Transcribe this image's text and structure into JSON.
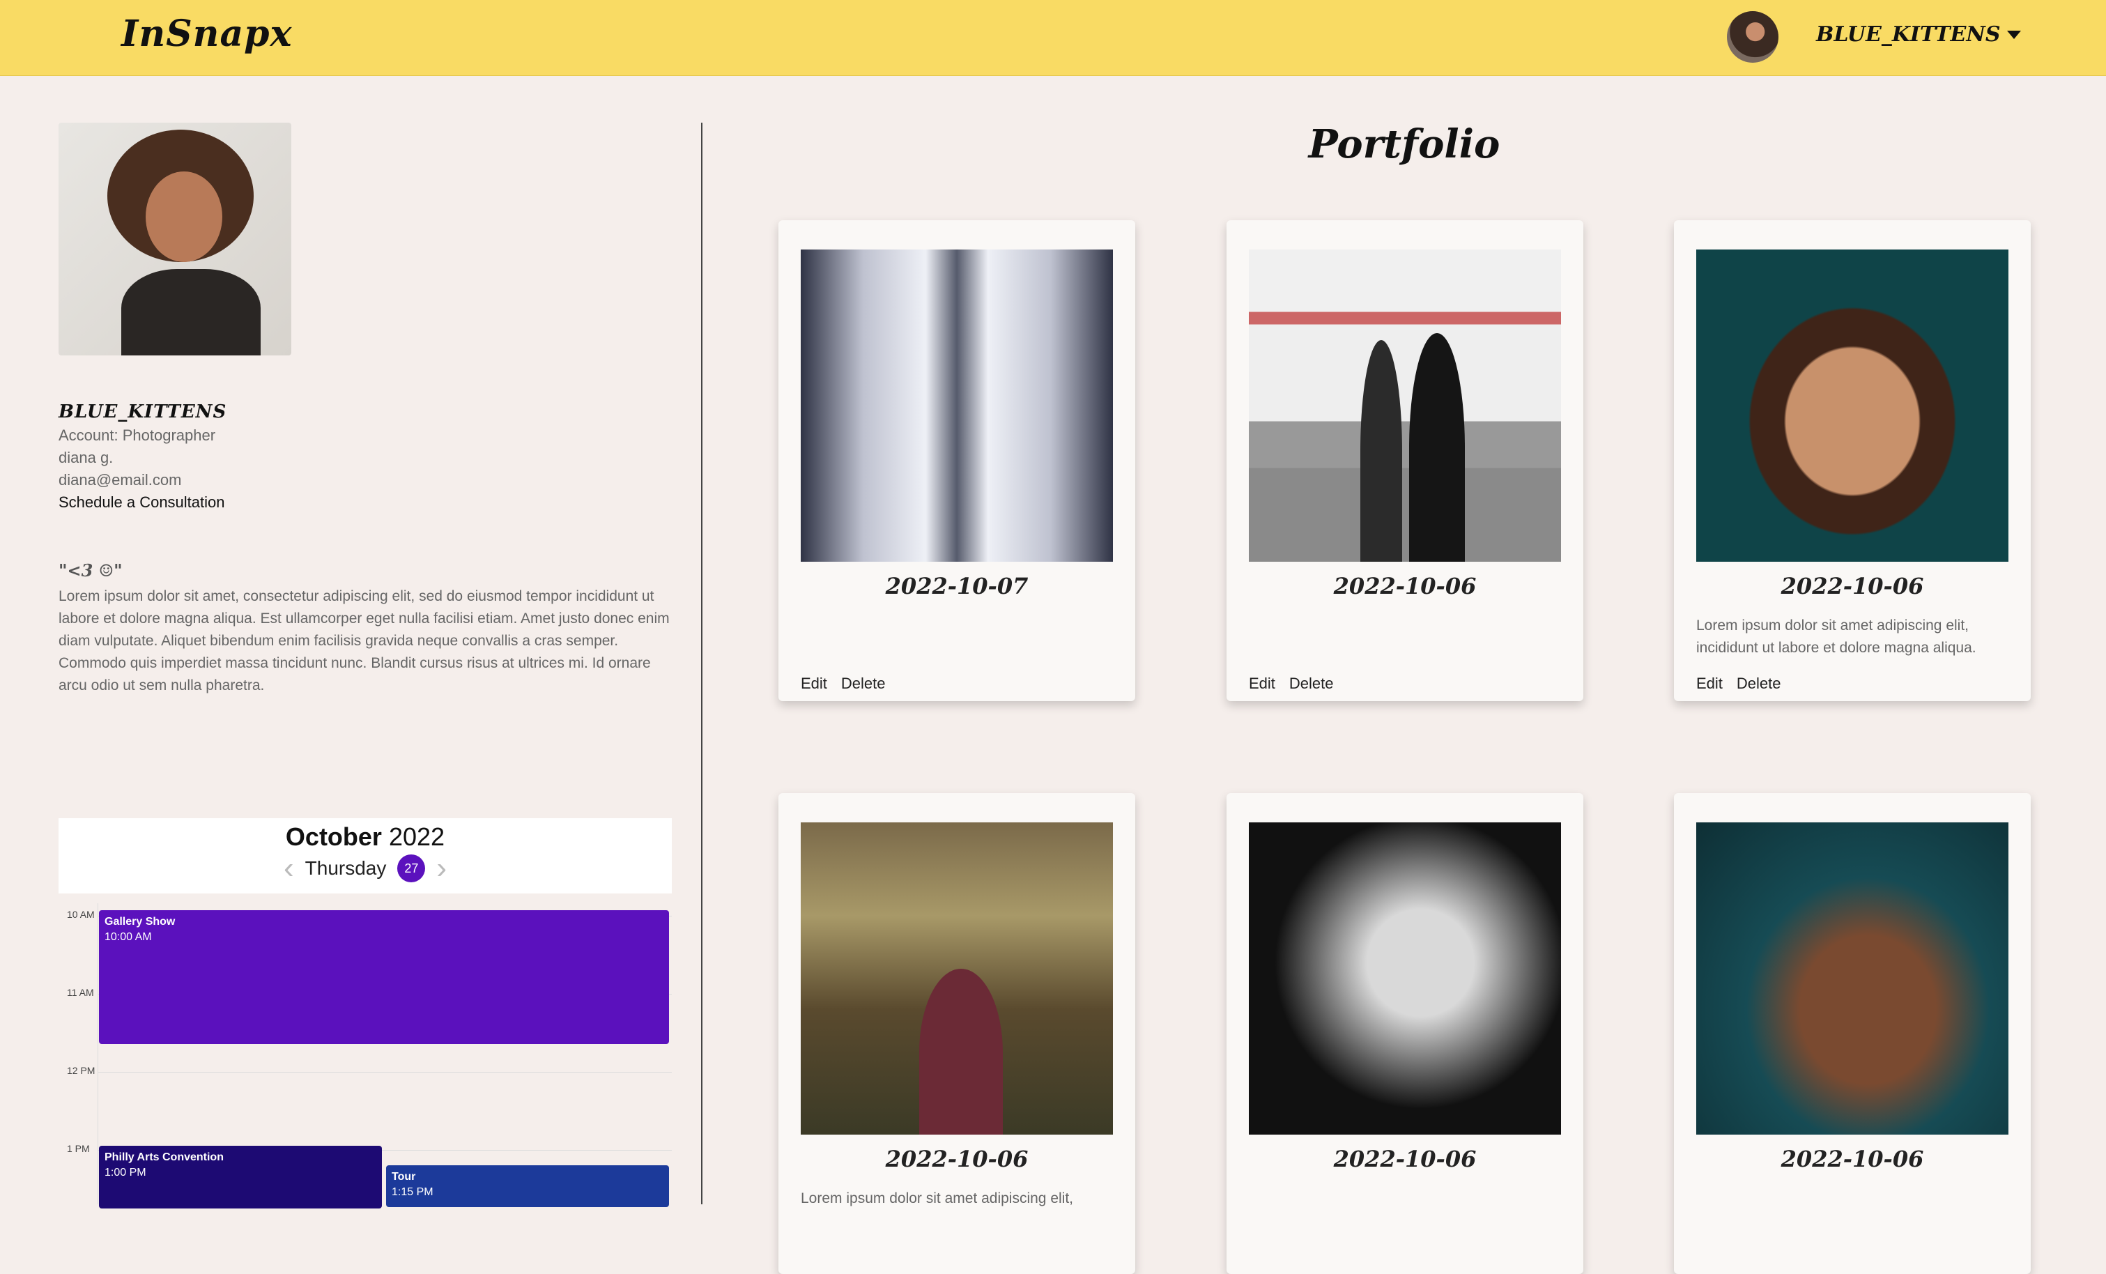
{
  "header": {
    "brand": "InSnapx",
    "user_menu_label": "BLUE_KITTENS"
  },
  "profile": {
    "username": "BLUE_KITTENS",
    "account_type": "Account: Photographer",
    "name": "diana g.",
    "email": "diana@email.com",
    "schedule_link": "Schedule a Consultation",
    "quote": "\"<3 ☺\"",
    "bio": "Lorem ipsum dolor sit amet, consectetur adipiscing elit, sed do eiusmod tempor incididunt ut labore et dolore magna aliqua. Est ullamcorper eget nulla facilisi etiam. Amet justo donec enim diam vulputate. Aliquet bibendum enim facilisis gravida neque convallis a cras semper. Commodo quis imperdiet massa tincidunt nunc. Blandit cursus risus at ultrices mi. Id ornare arcu odio ut sem nulla pharetra."
  },
  "calendar": {
    "month": "October",
    "year": "2022",
    "weekday": "Thursday",
    "day": "27",
    "hours": [
      "10 AM",
      "11 AM",
      "12 PM",
      "1 PM"
    ],
    "events": [
      {
        "title": "Gallery Show",
        "time": "10:00 AM",
        "color": "#5b11bd"
      },
      {
        "title": "Philly Arts Convention",
        "time": "1:00 PM",
        "color": "#1d0a73"
      },
      {
        "title": "Tour",
        "time": "1:15 PM",
        "color": "#1c3a9a"
      }
    ]
  },
  "portfolio": {
    "title": "Portfolio",
    "edit_label": "Edit",
    "delete_label": "Delete",
    "cards": [
      {
        "date": "2022-10-07",
        "caption": ""
      },
      {
        "date": "2022-10-06",
        "caption": ""
      },
      {
        "date": "2022-10-06",
        "caption": "Lorem ipsum dolor sit amet adipiscing elit, incididunt ut labore et dolore magna aliqua."
      },
      {
        "date": "2022-10-06",
        "caption": "Lorem ipsum dolor sit amet adipiscing elit,"
      },
      {
        "date": "2022-10-06",
        "caption": ""
      },
      {
        "date": "2022-10-06",
        "caption": ""
      }
    ]
  },
  "colors": {
    "header_bg": "#f9db64",
    "page_bg": "#f5eeeb",
    "accent_purple": "#5b11bd"
  }
}
